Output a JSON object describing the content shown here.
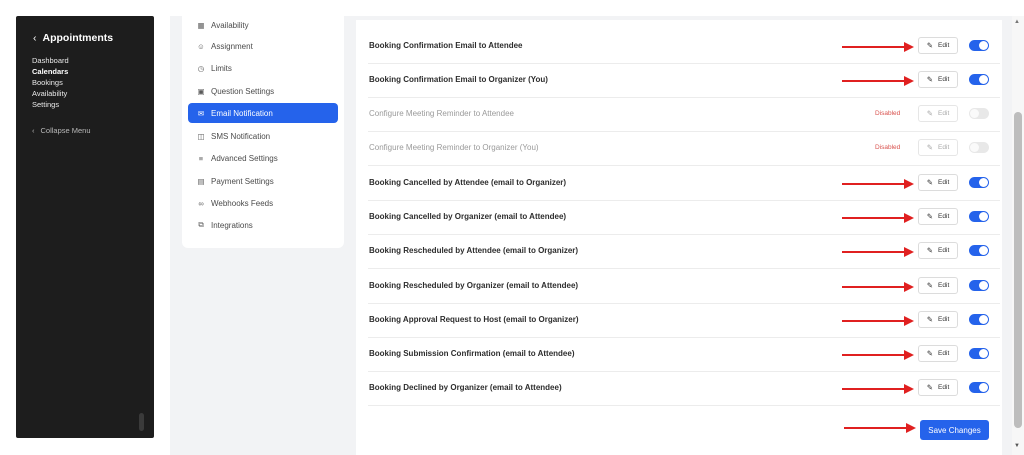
{
  "sidebar": {
    "title": "Appointments",
    "back_icon": "chevron-left-icon",
    "nav": [
      "Dashboard",
      "Calendars",
      "Bookings",
      "Availability",
      "Settings"
    ],
    "active_nav": "Calendars",
    "collapse_label": "Collapse Menu"
  },
  "settings_menu": {
    "items": [
      {
        "label": "Availability",
        "icon": "calendar-icon"
      },
      {
        "label": "Assignment",
        "icon": "users-icon"
      },
      {
        "label": "Limits",
        "icon": "clock-icon"
      },
      {
        "label": "Question Settings",
        "icon": "question-icon"
      },
      {
        "label": "Email Notification",
        "icon": "mail-icon"
      },
      {
        "label": "SMS Notification",
        "icon": "sms-icon"
      },
      {
        "label": "Advanced Settings",
        "icon": "sliders-icon"
      },
      {
        "label": "Payment Settings",
        "icon": "payment-icon"
      },
      {
        "label": "Webhooks Feeds",
        "icon": "link-icon"
      },
      {
        "label": "Integrations",
        "icon": "integrations-icon"
      }
    ],
    "active": "Email Notification"
  },
  "notifications": {
    "edit_label": "Edit",
    "edit_icon": "pencil-icon",
    "rows": [
      {
        "label": "Booking Confirmation Email to Attendee",
        "enabled": true,
        "status": ""
      },
      {
        "label": "Booking Confirmation Email to Organizer (You)",
        "enabled": true,
        "status": ""
      },
      {
        "label": "Configure Meeting Reminder to Attendee",
        "enabled": false,
        "status": "Disabled"
      },
      {
        "label": "Configure Meeting Reminder to Organizer (You)",
        "enabled": false,
        "status": "Disabled"
      },
      {
        "label": "Booking Cancelled by Attendee (email to Organizer)",
        "enabled": true,
        "status": ""
      },
      {
        "label": "Booking Cancelled by Organizer (email to Attendee)",
        "enabled": true,
        "status": ""
      },
      {
        "label": "Booking Rescheduled by Attendee (email to Organizer)",
        "enabled": true,
        "status": ""
      },
      {
        "label": "Booking Rescheduled by Organizer (email to Attendee)",
        "enabled": true,
        "status": ""
      },
      {
        "label": "Booking Approval Request to Host (email to Organizer)",
        "enabled": true,
        "status": ""
      },
      {
        "label": "Booking Submission Confirmation (email to Attendee)",
        "enabled": true,
        "status": ""
      },
      {
        "label": "Booking Declined by Organizer (email to Attendee)",
        "enabled": true,
        "status": ""
      }
    ]
  },
  "save_label": "Save Changes",
  "colors": {
    "accent": "#2563eb",
    "annotation_arrow": "#e02020",
    "disabled_text": "#d9534f",
    "sidebar_bg": "#1d1d1d"
  }
}
